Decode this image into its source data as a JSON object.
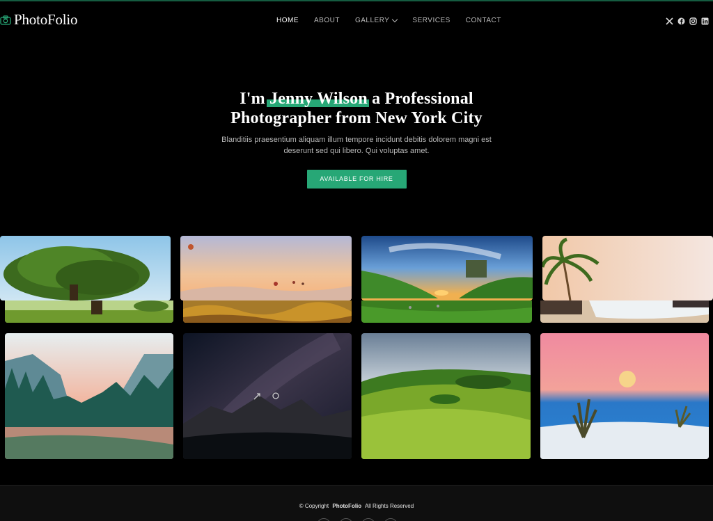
{
  "brand": {
    "name": "PhotoFolio",
    "icon": "camera-icon",
    "accent": "#27a776"
  },
  "nav": {
    "items": [
      {
        "label": "HOME",
        "active": true
      },
      {
        "label": "ABOUT"
      },
      {
        "label": "GALLERY"
      },
      {
        "label": "SERVICES"
      },
      {
        "label": "CONTACT"
      }
    ]
  },
  "social": [
    "x-icon",
    "facebook-icon",
    "instagram-icon",
    "linkedin-icon"
  ],
  "hero": {
    "title_prefix": "I'm",
    "title_name": "Jenny Wilson",
    "title_suffix": "a Professional",
    "title_line2": "Photographer from New York City",
    "description": "Blanditiis praesentium aliquam illum tempore incidunt debitis dolorem magni est deserunt sed qui libero. Qui voluptas amet.",
    "cta": "AVAILABLE FOR HIRE"
  },
  "gallery": [
    {
      "subject": "oak-tree"
    },
    {
      "subject": "hot-air-balloons"
    },
    {
      "subject": "green-valley-sunset"
    },
    {
      "subject": "palm-beach"
    },
    {
      "subject": "misty-forest-river"
    },
    {
      "subject": "milky-way-mountains"
    },
    {
      "subject": "green-hills"
    },
    {
      "subject": "moonrise-desert"
    }
  ],
  "footer": {
    "copyright_prefix": "© Copyright",
    "copyright_brand": "PhotoFolio",
    "copyright_suffix": "All Rights Reserved"
  }
}
